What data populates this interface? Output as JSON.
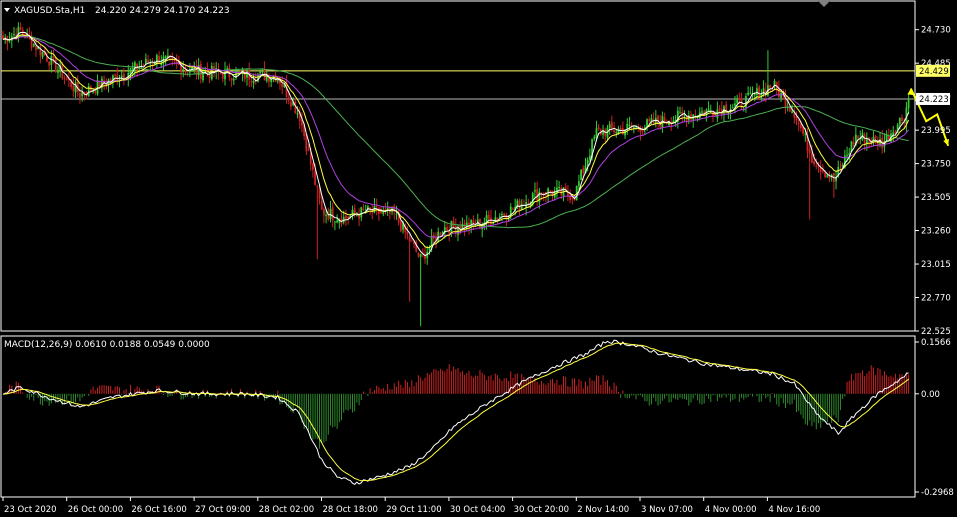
{
  "chart_data": [
    {
      "type": "candlestick",
      "title": "XAGUSD.Sta,H1",
      "ohlc_label": "24.220 24.279 24.170 24.223",
      "y_ticks": [
        "24.730",
        "24.485",
        "24.240",
        "23.995",
        "23.750",
        "23.505",
        "23.260",
        "23.015",
        "22.770",
        "22.525"
      ],
      "ylim": [
        22.525,
        24.94
      ],
      "price_lines": [
        {
          "label": "24.429",
          "value": 24.429,
          "color": "#ffff66",
          "badge_bg": "#ffff66",
          "badge_fg": "#000000"
        },
        {
          "label": "24.223",
          "value": 24.223,
          "color": "#b8b8b8",
          "badge_bg": "#ffffff",
          "badge_fg": "#000000"
        }
      ],
      "colors": {
        "up": "#33cc33",
        "down": "#cc2222",
        "ma_fast": "#ffffff",
        "ma_yellow": "#ffff44",
        "ma_purple": "#b040e0",
        "ma_slow": "#4caf50",
        "arrow": "#ffff00"
      },
      "x_labels": [
        "23 Oct 2020",
        "26 Oct 00:00",
        "26 Oct 16:00",
        "27 Oct 09:00",
        "28 Oct 02:00",
        "28 Oct 18:00",
        "29 Oct 11:00",
        "30 Oct 04:00",
        "30 Oct 20:00",
        "2 Nov 14:00",
        "3 Nov 07:00",
        "4 Nov 00:00",
        "4 Nov 16:00"
      ],
      "close_anchors": [
        [
          0,
          24.66
        ],
        [
          8,
          24.72
        ],
        [
          20,
          24.53
        ],
        [
          35,
          24.26
        ],
        [
          50,
          24.37
        ],
        [
          70,
          24.52
        ],
        [
          90,
          24.42
        ],
        [
          110,
          24.4
        ],
        [
          125,
          24.39
        ],
        [
          135,
          24.1
        ],
        [
          145,
          23.4
        ],
        [
          155,
          23.35
        ],
        [
          165,
          23.4
        ],
        [
          178,
          23.38
        ],
        [
          190,
          23.05
        ],
        [
          200,
          23.28
        ],
        [
          215,
          23.3
        ],
        [
          230,
          23.4
        ],
        [
          245,
          23.55
        ],
        [
          260,
          23.52
        ],
        [
          270,
          23.98
        ],
        [
          290,
          24.02
        ],
        [
          310,
          24.1
        ],
        [
          335,
          24.18
        ],
        [
          350,
          24.33
        ],
        [
          360,
          24.13
        ],
        [
          368,
          23.8
        ],
        [
          378,
          23.62
        ],
        [
          388,
          23.95
        ],
        [
          400,
          23.9
        ],
        [
          410,
          24.1
        ],
        [
          412,
          24.223
        ]
      ],
      "forecast_arrow": [
        [
          413,
          24.3
        ],
        [
          420,
          24.06
        ],
        [
          425,
          24.11
        ],
        [
          430,
          23.88
        ],
        [
          436,
          23.86
        ],
        [
          442,
          23.72
        ]
      ]
    },
    {
      "type": "macd",
      "label": "MACD(12,26,9) 0.0610 0.0188 0.0549 0.0000",
      "y_ticks": [
        "0.1566",
        "0.00",
        "-0.2968"
      ],
      "ylim": [
        -0.2968,
        0.1566
      ],
      "anchors": [
        [
          0,
          0.0
        ],
        [
          8,
          0.02
        ],
        [
          20,
          -0.01
        ],
        [
          35,
          -0.04
        ],
        [
          50,
          -0.01
        ],
        [
          70,
          0.01
        ],
        [
          90,
          0.0
        ],
        [
          110,
          0.0
        ],
        [
          125,
          -0.01
        ],
        [
          135,
          -0.06
        ],
        [
          145,
          -0.2
        ],
        [
          152,
          -0.25
        ],
        [
          160,
          -0.27
        ],
        [
          172,
          -0.25
        ],
        [
          185,
          -0.22
        ],
        [
          195,
          -0.17
        ],
        [
          205,
          -0.1
        ],
        [
          220,
          -0.03
        ],
        [
          235,
          0.03
        ],
        [
          250,
          0.08
        ],
        [
          265,
          0.12
        ],
        [
          275,
          0.16
        ],
        [
          285,
          0.15
        ],
        [
          300,
          0.12
        ],
        [
          320,
          0.09
        ],
        [
          350,
          0.06
        ],
        [
          360,
          0.03
        ],
        [
          370,
          -0.06
        ],
        [
          380,
          -0.12
        ],
        [
          388,
          -0.06
        ],
        [
          398,
          0.0
        ],
        [
          412,
          0.061
        ]
      ]
    }
  ]
}
